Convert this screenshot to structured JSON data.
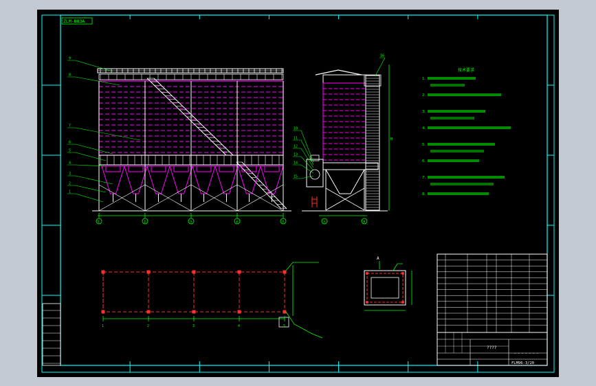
{
  "drawing": {
    "code_box": "ZLM-B83A",
    "bottom_title": "????",
    "drawing_number": "FLM96-3/20"
  },
  "notes": [
    "1.",
    "2.",
    "3.",
    "4.",
    "5.",
    "6.",
    "7.",
    "8."
  ],
  "elevation_callouts": [
    "1",
    "2",
    "3",
    "4",
    "5",
    "6",
    "7",
    "8",
    "9"
  ],
  "side_callouts": [
    "10",
    "11",
    "12",
    "13",
    "14",
    "15",
    "16"
  ],
  "elevation_axes": [
    "①",
    "②",
    "③",
    "④",
    "⑤"
  ],
  "side_axes": [
    "Ⓐ",
    "Ⓑ"
  ],
  "plan_axes": [
    "1",
    "2",
    "3",
    "4",
    "5"
  ],
  "detail_label": "A",
  "colors": {
    "frame": "#00ffff",
    "structure": "#ffffff",
    "filter_bag": "#ff00ff",
    "notes": "#00ff00",
    "plan_grid": "#ff3030",
    "dimension": "#00ff00",
    "titleblock": "#ffffff"
  }
}
